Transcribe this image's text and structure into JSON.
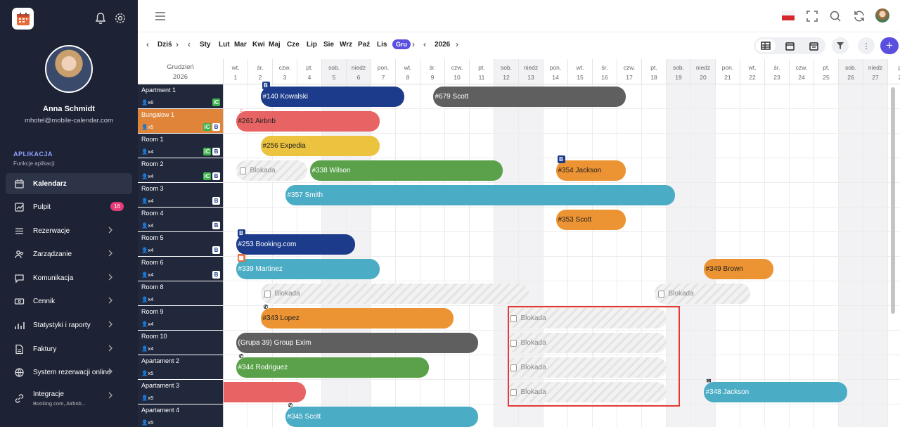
{
  "sidebar": {
    "user_name": "Anna Schmidt",
    "user_email": "mhotel@mobile-calendar.com",
    "section": "APLIKACJA",
    "section_sub": "Funkcje aplikacji",
    "items": [
      {
        "label": "Kalendarz",
        "icon": "calendar-icon"
      },
      {
        "label": "Pulpit",
        "icon": "dashboard-icon",
        "badge": "16"
      },
      {
        "label": "Rezerwacje",
        "icon": "list-icon"
      },
      {
        "label": "Zarządzanie",
        "icon": "users-icon"
      },
      {
        "label": "Komunikacja",
        "icon": "chat-icon"
      },
      {
        "label": "Cennik",
        "icon": "cash-icon"
      },
      {
        "label": "Statystyki i raporty",
        "icon": "stats-icon"
      },
      {
        "label": "Faktury",
        "icon": "invoice-icon"
      },
      {
        "label": "System rezerwacji online",
        "icon": "globe-icon"
      },
      {
        "label": "Integracje",
        "icon": "link-icon",
        "sub": "Booking.com, Airbnb..."
      }
    ]
  },
  "nav": {
    "today": "Dziś",
    "months": [
      "Sty",
      "Lut",
      "Mar",
      "Kwi",
      "Maj",
      "Cze",
      "Lip",
      "Sie",
      "Wrz",
      "Paź",
      "Lis",
      "Gru"
    ],
    "selected_month": "Gru",
    "year": "2026"
  },
  "grid": {
    "month_label": "Grudzień",
    "month_year": "2026",
    "days": [
      {
        "dow": "wt.",
        "d": "1"
      },
      {
        "dow": "śr.",
        "d": "2"
      },
      {
        "dow": "czw.",
        "d": "3"
      },
      {
        "dow": "pt.",
        "d": "4"
      },
      {
        "dow": "sob.",
        "d": "5",
        "w": true
      },
      {
        "dow": "niedz",
        "d": "6",
        "w": true
      },
      {
        "dow": "pon.",
        "d": "7"
      },
      {
        "dow": "wt.",
        "d": "8"
      },
      {
        "dow": "śr.",
        "d": "9"
      },
      {
        "dow": "czw.",
        "d": "10"
      },
      {
        "dow": "pt.",
        "d": "11"
      },
      {
        "dow": "sob.",
        "d": "12",
        "w": true
      },
      {
        "dow": "niedz",
        "d": "13",
        "w": true
      },
      {
        "dow": "pon.",
        "d": "14"
      },
      {
        "dow": "wt.",
        "d": "15"
      },
      {
        "dow": "śr.",
        "d": "16"
      },
      {
        "dow": "czw.",
        "d": "17"
      },
      {
        "dow": "pt.",
        "d": "18"
      },
      {
        "dow": "sob.",
        "d": "19",
        "w": true
      },
      {
        "dow": "niedz",
        "d": "20",
        "w": true
      },
      {
        "dow": "pon.",
        "d": "21"
      },
      {
        "dow": "wt.",
        "d": "22"
      },
      {
        "dow": "śr.",
        "d": "23"
      },
      {
        "dow": "czw.",
        "d": "24"
      },
      {
        "dow": "pt.",
        "d": "25"
      },
      {
        "dow": "sob.",
        "d": "26",
        "w": true
      },
      {
        "dow": "niedz",
        "d": "27",
        "w": true
      },
      {
        "dow": "p",
        "d": "2"
      }
    ],
    "rooms": [
      {
        "name": "Apartment 1",
        "cap": "x6",
        "ch": [
          "ic"
        ]
      },
      {
        "name": "Bungalow 1",
        "cap": "x5",
        "ch": [
          "ic",
          "B"
        ],
        "orange": true
      },
      {
        "name": "Room 1",
        "cap": "x4",
        "ch": [
          "ic",
          "B"
        ]
      },
      {
        "name": "Room 2",
        "cap": "x4",
        "ch": [
          "ic",
          "B"
        ]
      },
      {
        "name": "Room 3",
        "cap": "x4",
        "ch": [
          "B"
        ]
      },
      {
        "name": "Room 4",
        "cap": "x4",
        "ch": [
          "B"
        ]
      },
      {
        "name": "Room 5",
        "cap": "x4",
        "ch": [
          "B"
        ]
      },
      {
        "name": "Room 6",
        "cap": "x4",
        "ch": [
          "B"
        ]
      },
      {
        "name": "Room 8",
        "cap": "x4",
        "ch": []
      },
      {
        "name": "Room 9",
        "cap": "x4",
        "ch": []
      },
      {
        "name": "Room 10",
        "cap": "x4",
        "ch": []
      },
      {
        "name": "Apartament 2",
        "cap": "x5",
        "ch": []
      },
      {
        "name": "Apartament 3",
        "cap": "x5",
        "ch": []
      },
      {
        "name": "Apartament 4",
        "cap": "x5",
        "ch": []
      }
    ],
    "bookings": [
      {
        "row": 0,
        "s": 1.5,
        "e": 7.35,
        "label": "#140 Kowalski",
        "color": "#1c3b8b",
        "src": "B"
      },
      {
        "row": 0,
        "s": 8.5,
        "e": 16.35,
        "label": "#679 Scott",
        "color": "#5f5f5f"
      },
      {
        "row": 1,
        "s": 0.5,
        "e": 6.35,
        "label": "#261 Airbnb",
        "color": "#e86363",
        "dark": true,
        "src": "airbnb"
      },
      {
        "row": 2,
        "s": 1.5,
        "e": 6.35,
        "label": "#256 Expedia",
        "color": "#ecc33f",
        "dark": true
      },
      {
        "row": 3,
        "s": 3.5,
        "e": 11.35,
        "label": "#338 Wilson",
        "color": "#5aa14a"
      },
      {
        "row": 3,
        "s": 13.5,
        "e": 16.35,
        "label": "#354 Jackson",
        "color": "#ec9333",
        "dark": true,
        "src": "B"
      },
      {
        "row": 4,
        "s": 2.5,
        "e": 18.35,
        "label": "#357 Smith",
        "color": "#4aacc5"
      },
      {
        "row": 5,
        "s": 13.5,
        "e": 16.35,
        "label": "#353 Scott",
        "color": "#ec9333",
        "dark": true
      },
      {
        "row": 6,
        "s": 0.5,
        "e": 5.35,
        "label": "#253 Booking.com",
        "color": "#1c3b8b",
        "src": "B"
      },
      {
        "row": 7,
        "s": 0.5,
        "e": 6.35,
        "label": "#339 Martinez",
        "color": "#4aacc5",
        "src": "cal"
      },
      {
        "row": 7,
        "s": 19.5,
        "e": 22.35,
        "label": "#349 Brown",
        "color": "#ec9333",
        "dark": true
      },
      {
        "row": 9,
        "s": 1.5,
        "e": 9.35,
        "label": "#343 Lopez",
        "color": "#ec9333",
        "dark": true,
        "src": "phone"
      },
      {
        "row": 10,
        "s": 0.5,
        "e": 10.35,
        "label": "(Grupa 39) Group Exim",
        "color": "#5f5f5f"
      },
      {
        "row": 11,
        "s": 0.5,
        "e": 8.35,
        "label": "#344 Rodriguez",
        "color": "#5aa14a",
        "src": "phone"
      },
      {
        "row": 12,
        "s": 0,
        "e": 3.35,
        "label": "",
        "color": "#e86363"
      },
      {
        "row": 12,
        "s": 19.5,
        "e": 25.35,
        "label": "#348 Jackson",
        "color": "#4aacc5",
        "src": "mail"
      },
      {
        "row": 13,
        "s": 2.5,
        "e": 10.35,
        "label": "#345 Scott",
        "color": "#4aacc5",
        "src": "phone"
      }
    ],
    "blocks": [
      {
        "row": 3,
        "s": 0.5,
        "e": 3.4,
        "label": "Blokada"
      },
      {
        "row": 5,
        "s": 27.5,
        "e": 28,
        "label": ""
      },
      {
        "row": 8,
        "s": 1.5,
        "e": 12.4,
        "label": "Blokada"
      },
      {
        "row": 8,
        "s": 17.5,
        "e": 21.4,
        "label": "Blokada"
      },
      {
        "row": 9,
        "s": 11.5,
        "e": 18.0,
        "label": "Blokada"
      },
      {
        "row": 10,
        "s": 11.5,
        "e": 18.0,
        "label": "Blokada"
      },
      {
        "row": 11,
        "s": 11.5,
        "e": 18.0,
        "label": "Blokada"
      },
      {
        "row": 12,
        "s": 11.5,
        "e": 18.0,
        "label": "Blokada"
      }
    ]
  },
  "colors": {
    "accent": "#5b4fe0",
    "sidebar": "#1d2335",
    "highlight": "#e53935"
  }
}
